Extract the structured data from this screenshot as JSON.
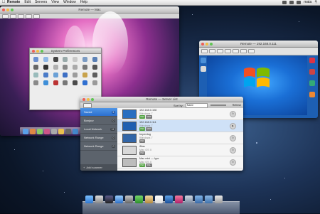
{
  "menubar": {
    "app": "Remote",
    "items": [
      "Edit",
      "Servers",
      "View",
      "Window",
      "Help"
    ],
    "clock": "mata"
  },
  "mac_window": {
    "title": "Remote — Mac"
  },
  "prefs_window": {
    "title": "System Preferences"
  },
  "win7_window": {
    "title": "Remote — 192.168.0.111"
  },
  "remote_window": {
    "title": "Remote — Server List",
    "sort_label": "Sort by:",
    "sort_value": "Name",
    "refresh_label": "Refresh",
    "sidebar": [
      {
        "label": "Saved",
        "count": "5",
        "selected": true
      },
      {
        "label": "Bonjour",
        "count": "0",
        "selected": false
      },
      {
        "label": "Local Network",
        "count": "11",
        "selected": false
      },
      {
        "label": "Network Range",
        "count": "0",
        "selected": false
      },
      {
        "label": "Network Range",
        "count": "0",
        "selected": false
      }
    ],
    "add_label": "Add scanner",
    "rows": [
      {
        "name": "192.168.0.108",
        "os": "Windows 7",
        "tags": [
          "VNC",
          "RDP"
        ],
        "selected": false
      },
      {
        "name": "192.168.0.111",
        "os": "Windows 7",
        "tags": [
          "VNC",
          "RDP"
        ],
        "selected": true
      },
      {
        "name": "Imperdog",
        "os": "Windows 7",
        "tags": [
          "VNC"
        ],
        "selected": false
      },
      {
        "name": "iMac",
        "os": "Mac OS X",
        "tags": [
          "VNC"
        ],
        "selected": false
      },
      {
        "name": "Mac mini — Igor",
        "os": "Mac OS X",
        "tags": [
          "VNC",
          "SSH"
        ],
        "selected": false
      }
    ]
  },
  "colors": {
    "accent": "#2c6fcf",
    "sidebar": "#5c636c",
    "selected_row": "#cfe1f7"
  }
}
